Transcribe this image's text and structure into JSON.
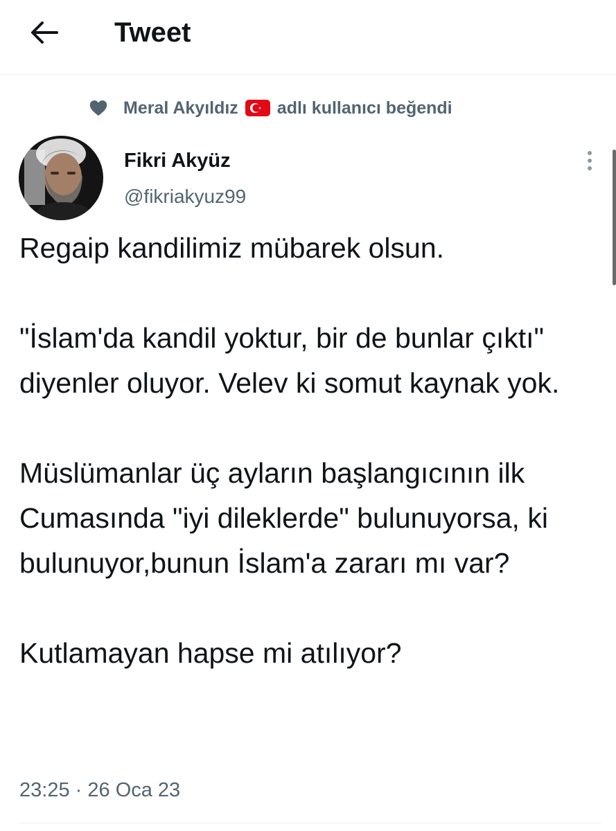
{
  "header": {
    "title": "Tweet",
    "back_icon": "arrow-left-icon"
  },
  "social_context": {
    "icon": "heart-icon",
    "user_name": "Meral Akyıldız",
    "flag": "turkey-flag-emoji",
    "suffix": "adlı kullanıcı beğendi"
  },
  "author": {
    "name": "Fikri Akyüz",
    "handle": "@fikriakyuz99",
    "more_icon": "more-vertical-icon"
  },
  "tweet": {
    "paragraphs": [
      "Regaip kandilimiz mübarek olsun.",
      "\"İslam'da kandil yoktur, bir de bunlar çıktı\" diyenler oluyor. Velev ki somut kaynak yok.",
      "Müslümanlar üç ayların başlangıcının ilk Cumasında \"iyi dileklerde\" bulunuyorsa, ki bulunuyor,bunun İslam'a zararı mı var?",
      "Kutlamayan hapse mi atılıyor?"
    ],
    "time": "23:25",
    "separator": "·",
    "date": "26 Oca 23"
  },
  "colors": {
    "text_primary": "#0f1419",
    "text_secondary": "#536471",
    "divider": "#eff3f4",
    "flag_red": "#e30a17"
  }
}
